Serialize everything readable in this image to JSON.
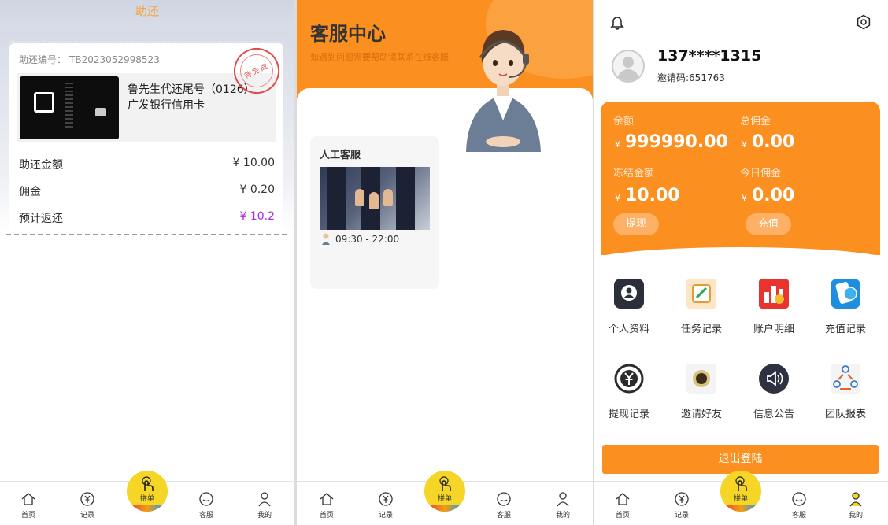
{
  "panel1": {
    "title": "助还",
    "ticket_no_label": "助还编号：",
    "ticket_no": "TB2023052998523",
    "stamp_text": "待完成",
    "card_line1": "鲁先生代还尾号（0126）",
    "card_line2": "广发银行信用卡",
    "rows": [
      {
        "label": "助还金额",
        "value": "¥ 10.00",
        "color": "#333333"
      },
      {
        "label": "佣金",
        "value": "¥ 0.20",
        "color": "#333333"
      },
      {
        "label": "预计返还",
        "value": "¥ 10.2",
        "color": "#b12bd6"
      }
    ]
  },
  "tabbar": {
    "home": "首页",
    "records": "记录",
    "center": "拼单",
    "service": "客服",
    "mine": "我的"
  },
  "panel2": {
    "title": "客服中心",
    "subtitle": "如遇到问题需要帮助请联系在线客服",
    "card_title": "人工客服",
    "hours": "09:30 - 22:00"
  },
  "panel3": {
    "phone": "137****1315",
    "invite": "邀请码:651763",
    "balance_label": "余额",
    "balance": "999990.00",
    "total_comm_label": "总佣金",
    "total_comm": "0.00",
    "frozen_label": "冻结金额",
    "frozen": "10.00",
    "today_comm_label": "今日佣金",
    "today_comm": "0.00",
    "currency": "¥",
    "withdraw_btn": "提现",
    "recharge_btn": "充值",
    "menu": [
      {
        "label": "个人资料",
        "icon": "profile-icon"
      },
      {
        "label": "任务记录",
        "icon": "task-record-icon"
      },
      {
        "label": "账户明细",
        "icon": "account-detail-icon"
      },
      {
        "label": "充值记录",
        "icon": "recharge-record-icon"
      },
      {
        "label": "提现记录",
        "icon": "withdraw-record-icon"
      },
      {
        "label": "邀请好友",
        "icon": "invite-friends-icon"
      },
      {
        "label": "信息公告",
        "icon": "announcement-icon"
      },
      {
        "label": "团队报表",
        "icon": "team-report-icon"
      }
    ],
    "logout": "退出登陆"
  },
  "colors": {
    "accent": "#fb8f1f",
    "center_button": "#f5d526",
    "refund_value": "#b12bd6"
  }
}
